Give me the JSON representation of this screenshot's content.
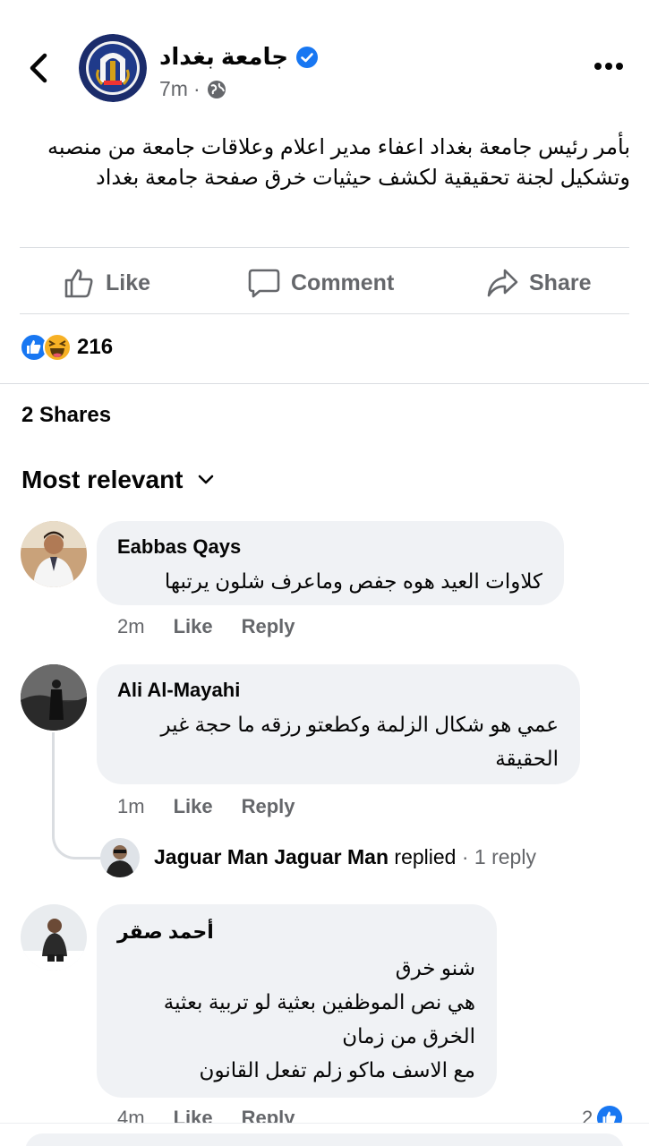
{
  "post": {
    "page_name": "جامعة  بغداد",
    "time": "7m",
    "separator": "·",
    "text": "بأمر رئيس جامعة بغداد اعفاء مدير اعلام وعلاقات جامعة من منصبه وتشكيل لجنة تحقيقية لكشف حيثيات خرق صفحة جامعة بغداد"
  },
  "actions": {
    "like": "Like",
    "comment": "Comment",
    "share": "Share"
  },
  "reactions": {
    "count": "216"
  },
  "shares": "2 Shares",
  "sort": {
    "label": "Most relevant"
  },
  "comments": [
    {
      "name": "Eabbas Qays",
      "text": "كلاوات العيد هوه جفص وماعرف شلون يرتبها",
      "time": "2m",
      "like": "Like",
      "reply": "Reply"
    },
    {
      "name": "Ali Al-Mayahi",
      "text": "عمي هو شكال الزلمة وكطعتو رزقه ما حجة غير الحقيقة",
      "time": "1m",
      "like": "Like",
      "reply": "Reply",
      "replies": {
        "name": "Jaguar Man Jaguar Man",
        "verb": "replied",
        "count": "· 1 reply"
      }
    },
    {
      "name": "أحمد صقر",
      "lines": [
        "شنو خرق",
        "هي نص الموظفين بعثية لو تربية بعثية",
        "الخرق من زمان",
        "مع الاسف ماكو زلم تفعل القانون"
      ],
      "time": "4m",
      "like": "Like",
      "reply": "Reply",
      "reaction_count": "2"
    }
  ],
  "colors": {
    "accent": "#1877f2",
    "secondary_text": "#65676b",
    "bubble": "#f0f2f5",
    "divider": "#dadde1"
  }
}
